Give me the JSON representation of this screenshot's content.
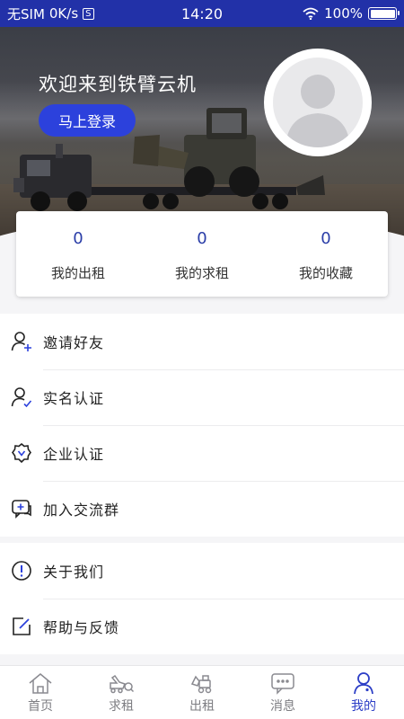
{
  "status_bar": {
    "sim": "无SIM",
    "speed": "0K/s",
    "sim_badge": "S",
    "time": "14:20",
    "battery": "100%",
    "battery_level": 1.0
  },
  "header": {
    "welcome": "欢迎来到铁臂云机",
    "login_label": "马上登录"
  },
  "stats": [
    {
      "value": "0",
      "label": "我的出租"
    },
    {
      "value": "0",
      "label": "我的求租"
    },
    {
      "value": "0",
      "label": "我的收藏"
    }
  ],
  "menu": {
    "group1": [
      {
        "label": "邀请好友",
        "icon": "invite-friend-icon"
      },
      {
        "label": "实名认证",
        "icon": "real-name-verify-icon"
      },
      {
        "label": "企业认证",
        "icon": "enterprise-verify-icon"
      },
      {
        "label": "加入交流群",
        "icon": "chat-group-icon"
      }
    ],
    "group2": [
      {
        "label": "关于我们",
        "icon": "info-icon"
      },
      {
        "label": "帮助与反馈",
        "icon": "feedback-icon"
      }
    ]
  },
  "tabs": [
    {
      "label": "首页",
      "icon": "home-icon"
    },
    {
      "label": "求租",
      "icon": "rent-request-icon"
    },
    {
      "label": "出租",
      "icon": "rent-out-icon"
    },
    {
      "label": "消息",
      "icon": "message-icon"
    },
    {
      "label": "我的",
      "icon": "profile-icon",
      "active": true
    }
  ],
  "colors": {
    "accent": "#2c41dc",
    "status_bar": "#2231a8",
    "stat_number": "#2b3ea8",
    "active_tab": "#2c3ec6"
  }
}
